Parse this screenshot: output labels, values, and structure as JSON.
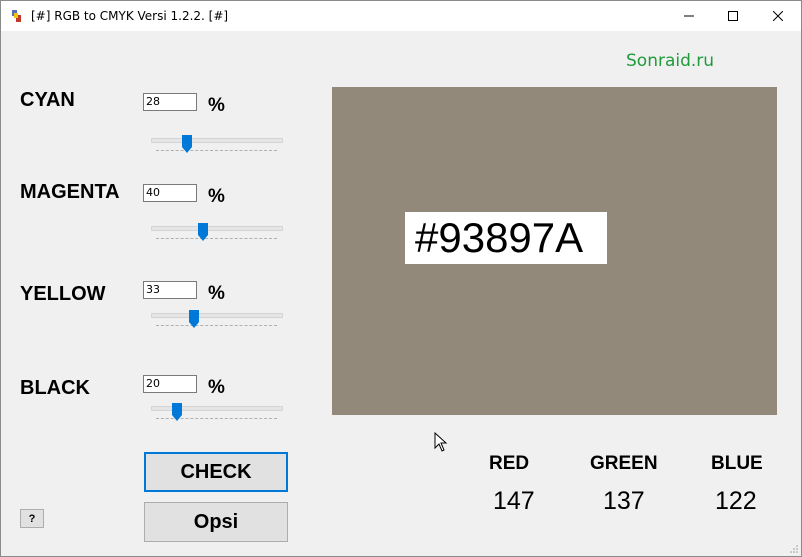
{
  "window": {
    "title": "[#] RGB to CMYK Versi 1.2.2. [#]"
  },
  "link": "Sonraid.ru",
  "colors": {
    "preview": "#93897A",
    "accent": "#0078d7",
    "link": "#1f9b3a"
  },
  "channels": [
    {
      "label": "CYAN",
      "value": "28",
      "percent_sign": "%",
      "level": 28
    },
    {
      "label": "MAGENTA",
      "value": "40",
      "percent_sign": "%",
      "level": 40
    },
    {
      "label": "YELLOW",
      "value": "33",
      "percent_sign": "%",
      "level": 33
    },
    {
      "label": "BLACK",
      "value": "20",
      "percent_sign": "%",
      "level": 20
    }
  ],
  "hex": "#93897A",
  "buttons": {
    "check": "CHECK",
    "opsi": "Opsi",
    "help": "?"
  },
  "rgb": {
    "red_label": "RED",
    "green_label": "GREEN",
    "blue_label": "BLUE",
    "red": "147",
    "green": "137",
    "blue": "122"
  },
  "icons": {
    "app": "app-icon",
    "minimize": "minimize-icon",
    "maximize": "maximize-icon",
    "close": "close-icon"
  }
}
